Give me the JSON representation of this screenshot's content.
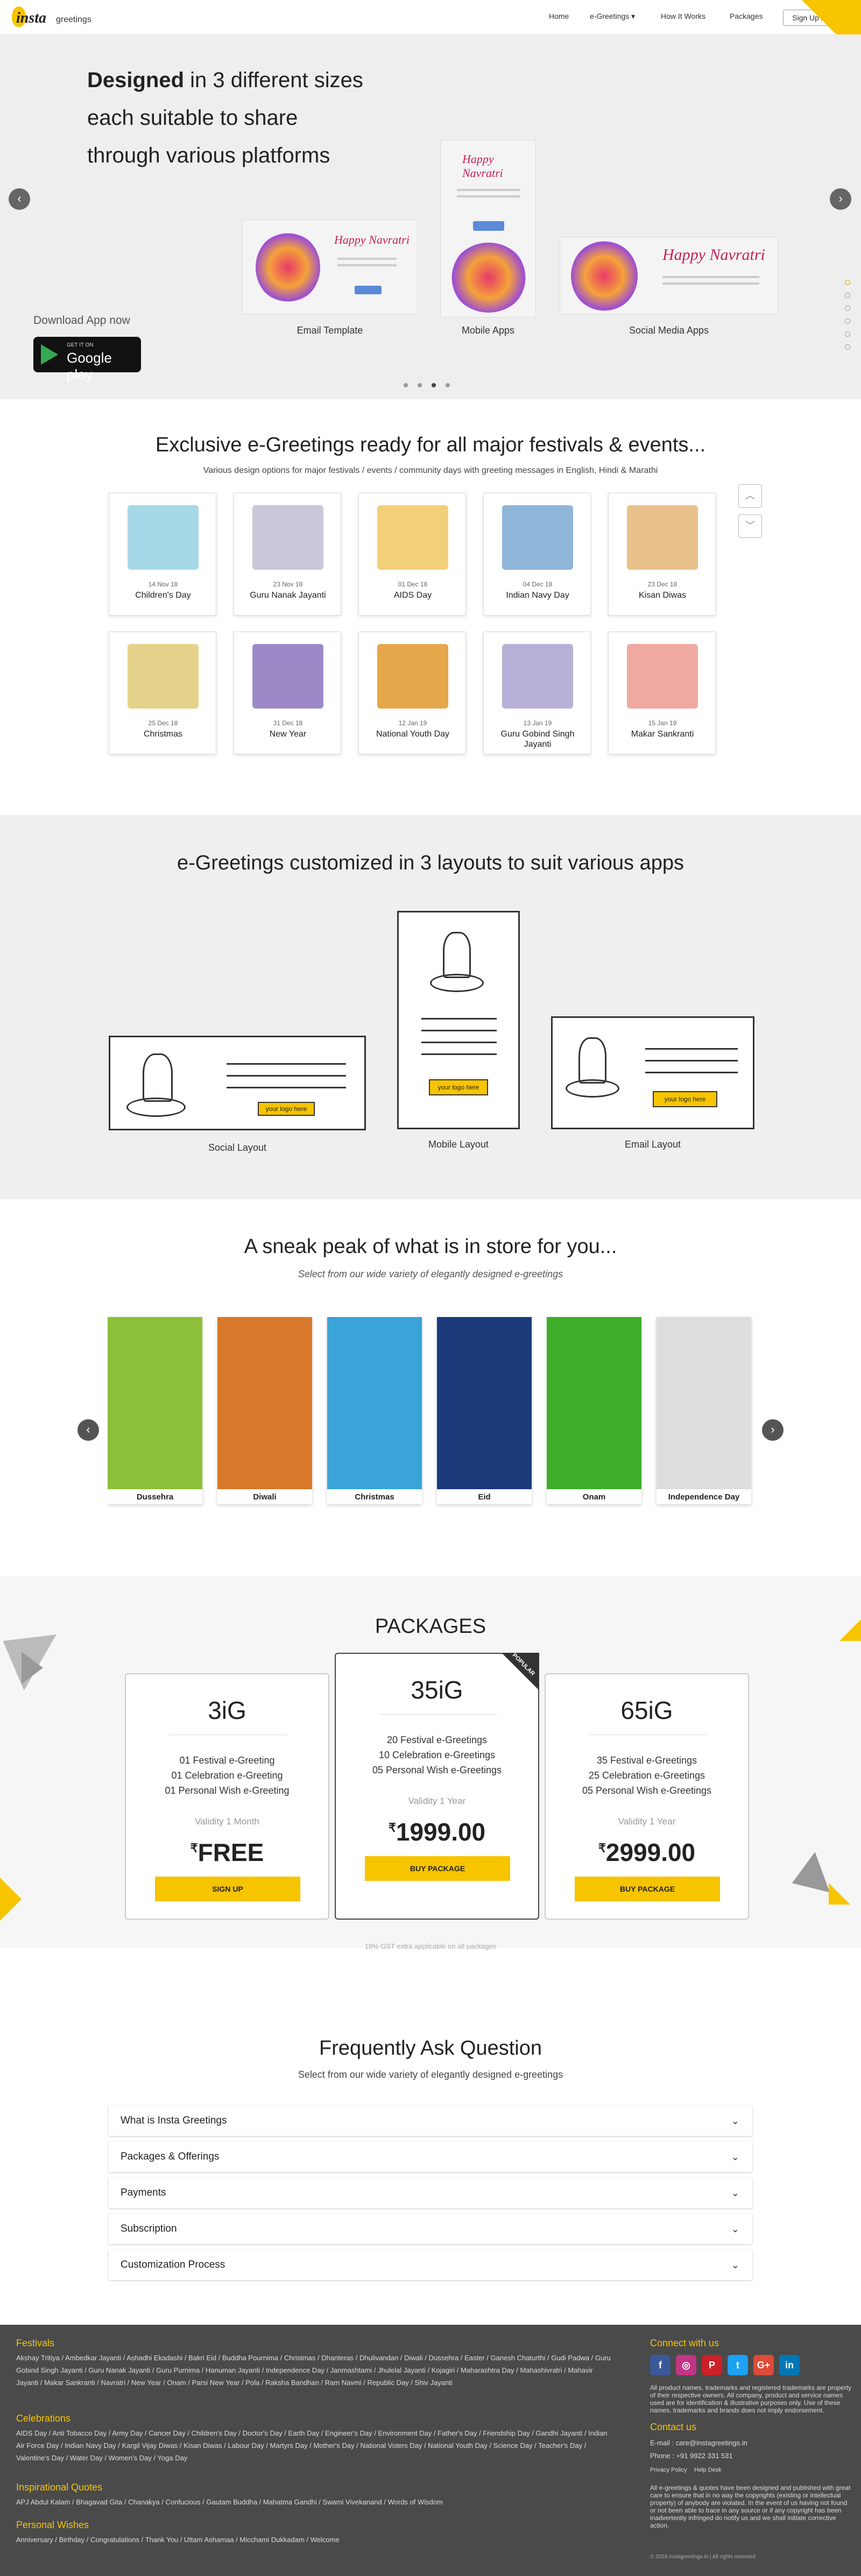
{
  "header": {
    "logo_text": "insta",
    "logo_suffix": "greetings",
    "nav": [
      "Home",
      "e-Greetings",
      "How It Works",
      "Packages"
    ],
    "login": "Sign Up / Login"
  },
  "hero": {
    "headline_bold": "Designed",
    "headline_rest": " in 3 different sizes",
    "line2": "each suitable to share",
    "line3": "through various platforms",
    "captions": [
      "Email Template",
      "Mobile Apps",
      "Social Media Apps"
    ],
    "card_title": "Happy Navratri",
    "download": "Download App now",
    "store_small": "GET IT ON",
    "store": "Google play",
    "slide_dots": 4,
    "active_slide": 3
  },
  "festivals": {
    "title": "Exclusive e-Greetings ready for all major festivals & events...",
    "subtitle": "Various design options for major festivals / events / community days with greeting messages in English, Hindi & Marathi",
    "items": [
      {
        "date": "14 Nov 18",
        "name": "Children's Day",
        "color": "#a7d8e8"
      },
      {
        "date": "23 Nov 18",
        "name": "Guru Nanak Jayanti",
        "color": "#c8c8d8"
      },
      {
        "date": "01 Dec 18",
        "name": "AIDS Day",
        "color": "#f2d07a"
      },
      {
        "date": "04 Dec 18",
        "name": "Indian Navy Day",
        "color": "#8fb5d9"
      },
      {
        "date": "23 Dec 18",
        "name": "Kisan Diwas",
        "color": "#e8c28a"
      },
      {
        "date": "25 Dec 18",
        "name": "Christmas",
        "color": "#e5d28a"
      },
      {
        "date": "31 Dec 18",
        "name": "New Year",
        "color": "#9c8ac8"
      },
      {
        "date": "12 Jan 19",
        "name": "National Youth Day",
        "color": "#e6a64a"
      },
      {
        "date": "13 Jan 19",
        "name": "Guru Gobind Singh Jayanti",
        "color": "#b9b0d8"
      },
      {
        "date": "15 Jan 19",
        "name": "Makar Sankranti",
        "color": "#f0a9a0"
      }
    ]
  },
  "layouts": {
    "title": "e-Greetings customized in 3 layouts to suit various apps",
    "badge": "your logo here",
    "labels": [
      "Social Layout",
      "Mobile Layout",
      "Email Layout"
    ]
  },
  "sneak": {
    "title": "A sneak peak of what is in store for you...",
    "subtitle": "Select from our wide variety of elegantly designed e-greetings",
    "cards": [
      {
        "name": "Dussehra",
        "color": "#8cbf3a"
      },
      {
        "name": "Diwali",
        "color": "#d8782a"
      },
      {
        "name": "Christmas",
        "color": "#3aa3d8"
      },
      {
        "name": "Eid",
        "color": "#1a3a7a"
      },
      {
        "name": "Onam",
        "color": "#3fae2a"
      },
      {
        "name": "Independence Day",
        "color": "#dddddd"
      }
    ]
  },
  "packages": {
    "title": "PACKAGES",
    "ribbon": "POPULAR",
    "items": [
      {
        "name": "3iG",
        "lines": [
          "01 Festival e-Greeting",
          "01 Celebration e-Greeting",
          "01 Personal Wish e-Greeting"
        ],
        "validity": "Validity 1 Month",
        "price": "FREE",
        "button": "SIGN UP"
      },
      {
        "name": "35iG",
        "lines": [
          "20 Festival e-Greetings",
          "10 Celebration e-Greetings",
          "05 Personal Wish e-Greetings"
        ],
        "validity": "Validity 1 Year",
        "price": "1999.00",
        "button": "BUY PACKAGE"
      },
      {
        "name": "65iG",
        "lines": [
          "35 Festival e-Greetings",
          "25 Celebration e-Greetings",
          "05 Personal Wish e-Greetings"
        ],
        "validity": "Validity 1 Year",
        "price": "2999.00",
        "button": "BUY PACKAGE"
      }
    ],
    "currency": "₹",
    "note": "18% GST extra applicable on all packages"
  },
  "faq": {
    "title": "Frequently Ask Question",
    "subtitle": "Select from our wide variety of elegantly designed e-greetings",
    "items": [
      "What is Insta Greetings",
      "Packages & Offerings",
      "Payments",
      "Subscription",
      "Customization Process"
    ]
  },
  "footer": {
    "festivals_title": "Festivals",
    "festivals": "Akshay Tritiya / Ambedkar Jayanti / Ashadhi Ekadashi / Bakri Eid / Buddha Pournima / Christmas / Dhanteras / Dhulivandan / Diwali / Dussehra / Easter / Ganesh Chaturthi / Gudi Padwa / Guru Gobind Singh Jayanti / Guru Nanak Jayanti / Guru Purnima / Hanuman Jayanti / Independence Day / Janmashtami / Jhulelal Jayanti / Kojagiri / Maharashtra Day / Mahashivratri / Mahavir Jayanti / Makar Sankranti / Navratri / New Year / Onam / Parsi New Year / Pola / Raksha Bandhan / Ram Navmi / Republic Day / Shiv Jayanti",
    "celebrations_title": "Celebrations",
    "celebrations": "AIDS Day / Anti Tobacco Day / Army Day / Cancer Day / Children's Day / Doctor's Day / Earth Day / Engineer's Day / Environment Day / Father's Day / Friendship Day / Gandhi Jayanti / Indian Air Force Day / Indian Navy Day / Kargil Vijay Diwas / Kisan Diwas / Labour Day / Martyrs Day / Mother's Day / National Voters Day / National Youth Day / Science Day / Teacher's Day / Valentine's Day / Water Day / Women's Day / Yoga Day",
    "quotes_title": "Inspirational Quotes",
    "quotes": "APJ Abdul Kalam / Bhagavad Gita / Chanakya / Confucious / Gautam Buddha / Mahatma Gandhi / Swami Vivekanand / Words of Wisdom",
    "wishes_title": "Personal Wishes",
    "wishes": "Anniversary / Birthday / Congratulations / Thank You / Uttam Ashamaa / Micchami Dukkadam / Welcome",
    "connect_title": "Connect with us",
    "disclaimer": "All product names, trademarks and registered trademarks are property of their respective owners. All company, product and service names used are for identification & illustrative purposes only. Use of these names, trademarks and brands does not imply endorsement.",
    "contact_title": "Contact us",
    "email": "E-mail : care@instagreetings.in",
    "phone": "Phone : +91 9922 331 531",
    "privacy": "Privacy Policy",
    "help": "Help Desk",
    "note2": "All e-greetings & quotes have been designed and published with great care to ensure that in no way the copyrights (existing or intellectual property) of anybody are violated. In the event of us having not found or not been able to trace in any source or if any copyright has been inadvertently infringed do notify us and we shall initiate corrective action.",
    "copyright": "© 2018 instagreetings.in | All rights reserved"
  }
}
